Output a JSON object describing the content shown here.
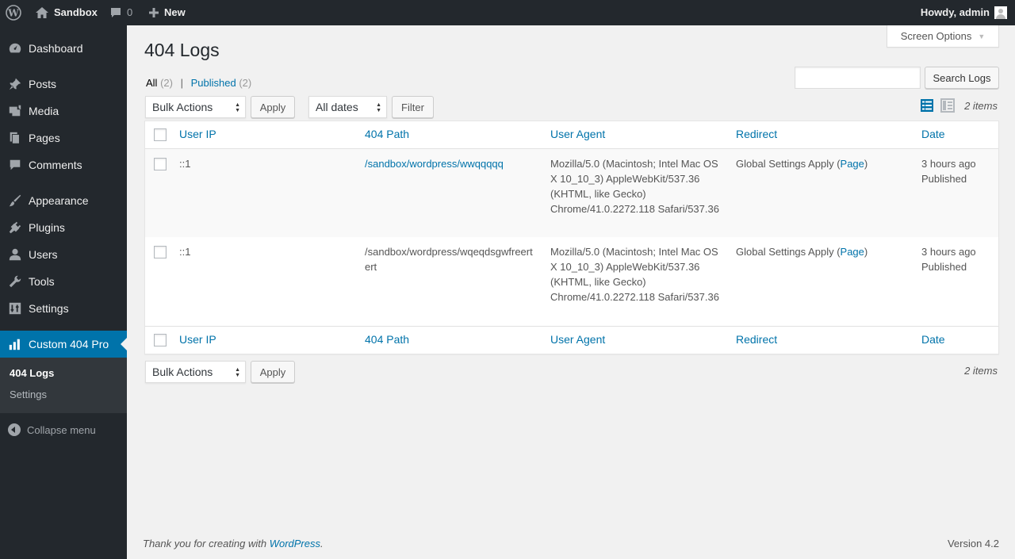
{
  "admin_bar": {
    "site_name": "Sandbox",
    "comments_count": "0",
    "new_label": "New",
    "howdy": "Howdy, admin"
  },
  "sidebar": {
    "items": [
      {
        "label": "Dashboard",
        "icon": "dashboard-icon"
      },
      {
        "label": "Posts",
        "icon": "pin-icon"
      },
      {
        "label": "Media",
        "icon": "media-icon"
      },
      {
        "label": "Pages",
        "icon": "pages-icon"
      },
      {
        "label": "Comments",
        "icon": "comment-icon"
      },
      {
        "label": "Appearance",
        "icon": "brush-icon"
      },
      {
        "label": "Plugins",
        "icon": "plug-icon"
      },
      {
        "label": "Users",
        "icon": "user-icon"
      },
      {
        "label": "Tools",
        "icon": "wrench-icon"
      },
      {
        "label": "Settings",
        "icon": "settings-icon"
      },
      {
        "label": "Custom 404 Pro",
        "icon": "bar-chart-icon"
      }
    ],
    "submenu": [
      "404 Logs",
      "Settings"
    ],
    "collapse": "Collapse menu"
  },
  "screen_options": "Screen Options",
  "page_title": "404 Logs",
  "views": {
    "all_label": "All",
    "all_count": "(2)",
    "separator": "|",
    "published_label": "Published",
    "published_count": "(2)"
  },
  "search": {
    "value": "",
    "button": "Search Logs"
  },
  "toolbar": {
    "bulk_actions": "Bulk Actions",
    "apply": "Apply",
    "dates": "All dates",
    "filter": "Filter",
    "items_count": "2 items"
  },
  "table": {
    "columns": [
      "User IP",
      "404 Path",
      "User Agent",
      "Redirect",
      "Date"
    ],
    "rows": [
      {
        "ip": "::1",
        "path": "/sandbox/wordpress/wwqqqqq",
        "agent": "Mozilla/5.0 (Macintosh; Intel Mac OS X 10_10_3) AppleWebKit/537.36 (KHTML, like Gecko) Chrome/41.0.2272.118 Safari/537.36",
        "redirect_prefix": "Global Settings Apply (",
        "redirect_link": "Page",
        "redirect_suffix": ")",
        "date": "3 hours ago",
        "status": "Published"
      },
      {
        "ip": "::1",
        "path": "/sandbox/wordpress/wqeqdsgwfreertert",
        "agent": "Mozilla/5.0 (Macintosh; Intel Mac OS X 10_10_3) AppleWebKit/537.36 (KHTML, like Gecko) Chrome/41.0.2272.118 Safari/537.36",
        "redirect_prefix": "Global Settings Apply (",
        "redirect_link": "Page",
        "redirect_suffix": ")",
        "date": "3 hours ago",
        "status": "Published"
      }
    ]
  },
  "footer": {
    "thanks_prefix": "Thank you for creating with ",
    "thanks_link": "WordPress",
    "thanks_suffix": ".",
    "version": "Version 4.2"
  },
  "colors": {
    "admin_bg": "#23282d",
    "accent": "#0073aa",
    "page_bg": "#f1f1f1"
  }
}
